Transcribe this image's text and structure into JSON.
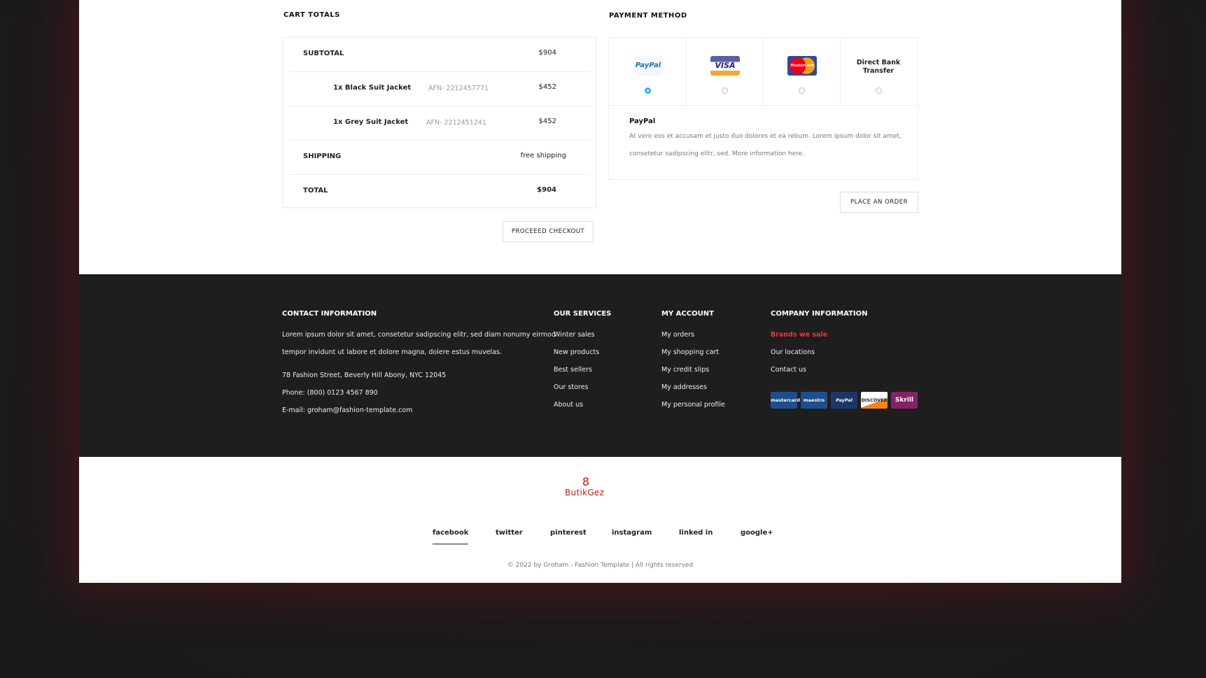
{
  "cart": {
    "title": "CART TOTALS",
    "subtotal_label": "SUBTOTAL",
    "subtotal_value": "$904",
    "items": [
      {
        "name": "1x Black Suit Jacket",
        "sku": "AFN- 2212457771",
        "price": "$452"
      },
      {
        "name": "1x Grey Suit Jacket",
        "sku": "AFN- 2212451241",
        "price": "$452"
      }
    ],
    "shipping_label": "SHIPPING",
    "shipping_value": "free shipping",
    "total_label": "TOTAL",
    "total_value": "$904",
    "checkout_button": "PROCEEED CHECKOUT"
  },
  "payment": {
    "title": "PAYMENT METHOD",
    "options": [
      {
        "label": "PayPal",
        "icon": "paypal-logo",
        "selected": true
      },
      {
        "label": "VISA",
        "icon": "visa-logo",
        "selected": false
      },
      {
        "label": "MasterCard",
        "icon": "mastercard-logo",
        "selected": false
      },
      {
        "label": "Direct Bank Transfer",
        "icon": "",
        "selected": false
      }
    ],
    "selected_name": "PayPal",
    "description": "At vero eos et accusam et justo duo dolores et ea rebum. Lorem ipsum dolor sit amet, consetetur sadipscing elitr, sed. More information here.",
    "order_button": "PLACE AN ORDER"
  },
  "footer": {
    "contact": {
      "title": "CONTACT INFORMATION",
      "text1": "Lorem ipsum dolor sit amet, consetetur sadipscing elitr, sed diam nonumy eirmod",
      "text2": "tempor invidunt ut labore et dolore magna, dolere estus muvelas.",
      "address": "78 Fashion Street, Beverly Hill Abony, NYC 12045",
      "phone": "Phone: (800) 0123 4567 890",
      "email": "E-mail:  groham@fashion-template.com"
    },
    "services": {
      "title": "OUR SERVICES",
      "links": [
        "Winter sales",
        "New products",
        "Best sellers",
        "Our stores",
        "About us"
      ]
    },
    "account": {
      "title": "MY ACCOUNT",
      "links": [
        "My orders",
        "My shopping cart",
        "My credit slips",
        "My addresses",
        "My personal profile"
      ]
    },
    "company": {
      "title": "COMPANY INFORMATION",
      "links": [
        "Brands we sale",
        "Our locations",
        "Contact us"
      ],
      "highlight_color": "#e53935"
    },
    "payment_cards": [
      "mastercard",
      "maestro",
      "PayPal",
      "DISCOVER",
      "Skrill"
    ]
  },
  "bottom": {
    "brand": "ButikGez",
    "social": [
      "facebook",
      "twitter",
      "pinterest",
      "instagram",
      "linked in",
      "google+"
    ],
    "active_social": "facebook",
    "copyright": "© 2022 by Groham - Fashion Template | All rights reserved"
  },
  "colors": {
    "accent_blue": "#29b6f6",
    "brand_red": "#b71c1c",
    "footer_bg": "#1e1e1e"
  }
}
